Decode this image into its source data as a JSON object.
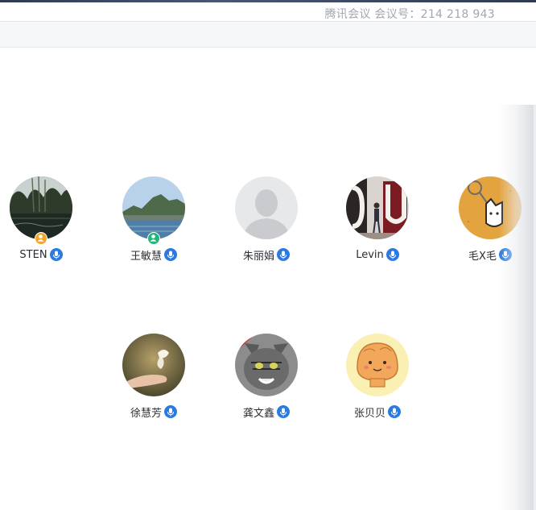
{
  "window": {
    "title": "腾讯会议 会议号：214 218 943"
  },
  "participants": [
    {
      "name": "STEN",
      "badge": "host",
      "badge_color": "#f0a72a",
      "mic": "on"
    },
    {
      "name": "王敏慧",
      "badge": "cohost",
      "badge_color": "#24b57a",
      "mic": "on"
    },
    {
      "name": "朱丽娟",
      "badge": "",
      "mic": "on"
    },
    {
      "name": "Levin",
      "badge": "",
      "mic": "on"
    },
    {
      "name": "毛X毛",
      "badge": "",
      "mic": "on"
    },
    {
      "name": "徐慧芳",
      "badge": "",
      "mic": "on"
    },
    {
      "name": "龚文鑫",
      "badge": "",
      "mic": "on"
    },
    {
      "name": "张贝贝",
      "badge": "",
      "mic": "on"
    }
  ],
  "colors": {
    "mic": "#2a7ae2",
    "title_text": "#a3a7af",
    "name_text": "#2b2e33"
  },
  "icons": {
    "mic": "microphone-icon",
    "host_badge": "user-icon",
    "cohost_badge": "user-icon"
  }
}
